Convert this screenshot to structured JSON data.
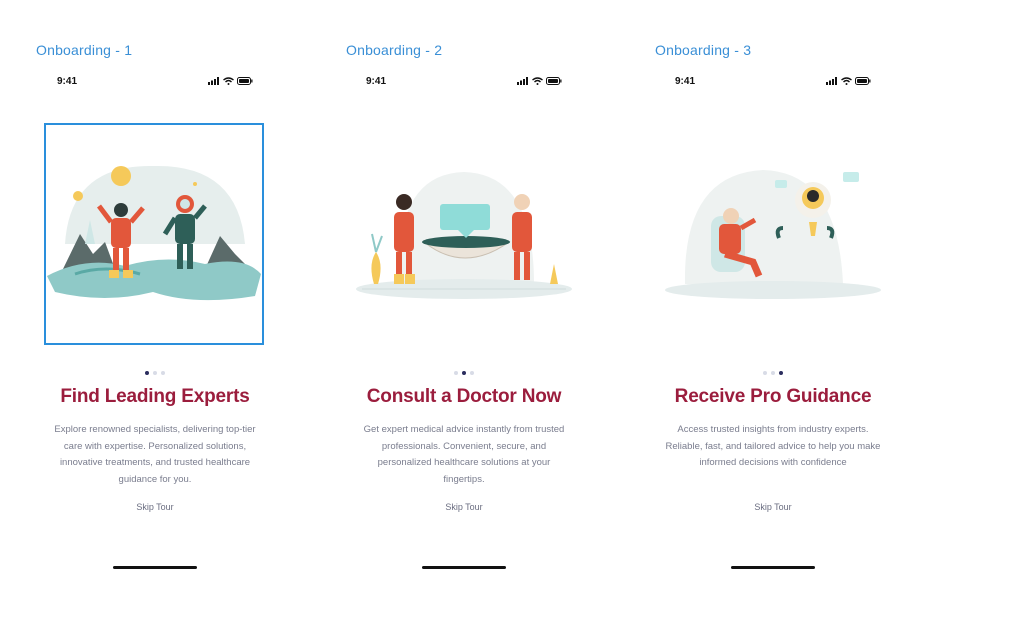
{
  "status_bar": {
    "time": "9:41"
  },
  "skip_label": "Skip Tour",
  "colors": {
    "label": "#3a8fd6",
    "title": "#9b1d3d",
    "body": "#7a7d8e",
    "dot_active": "#2b2d5e",
    "dot_inactive": "#d8dbe6"
  },
  "screens": [
    {
      "frame_label": "Onboarding - 1",
      "title": "Find Leading Experts",
      "description": "Explore renowned specialists, delivering top-tier care with expertise. Personalized solutions, innovative treatments, and trusted healthcare guidance for you.",
      "active_dot": 1
    },
    {
      "frame_label": "Onboarding - 2",
      "title": "Consult a Doctor Now",
      "description": "Get expert medical advice instantly from trusted professionals. Convenient, secure, and personalized healthcare solutions at your fingertips.",
      "active_dot": 2
    },
    {
      "frame_label": "Onboarding - 3",
      "title": "Receive Pro Guidance",
      "description": "Access trusted insights from industry experts. Reliable, fast, and tailored advice to help you make informed decisions with confidence",
      "active_dot": 3
    }
  ]
}
